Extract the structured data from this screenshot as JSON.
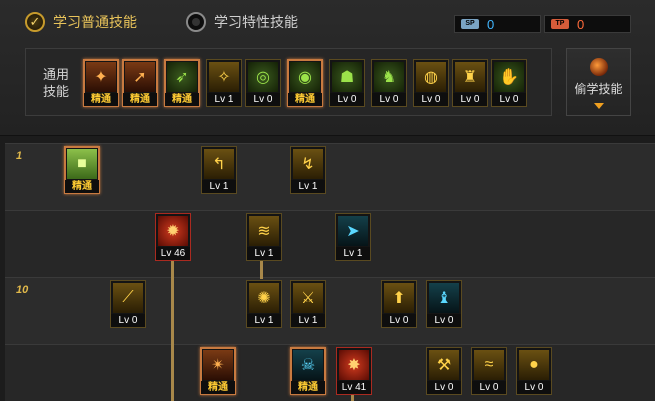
{
  "modes": {
    "normal_label": "学习普通技能",
    "special_label": "学习特性技能",
    "selected": "normal"
  },
  "currency": {
    "blue": {
      "tag": "SP",
      "value": "0"
    },
    "red": {
      "tag": "TP",
      "value": "0"
    }
  },
  "common": {
    "label_line1": "通用",
    "label_line2": "技能",
    "skills": [
      {
        "level": "精通",
        "master": true,
        "icon": "ground-slam-icon",
        "color": "orange"
      },
      {
        "level": "精通",
        "master": true,
        "icon": "leap-icon",
        "color": "orange"
      },
      {
        "level": "精通",
        "master": true,
        "icon": "dash-icon",
        "color": "green"
      },
      {
        "level": "Lv 1",
        "master": false,
        "icon": "wings-icon",
        "color": "gold"
      },
      {
        "level": "Lv 0",
        "master": false,
        "icon": "target-icon",
        "color": "green"
      },
      {
        "level": "精通",
        "master": true,
        "icon": "target-gear-icon",
        "color": "green"
      },
      {
        "level": "Lv 0",
        "master": false,
        "icon": "mushroom-icon",
        "color": "green"
      },
      {
        "level": "Lv 0",
        "master": false,
        "icon": "soldier-icon",
        "color": "green"
      },
      {
        "level": "Lv 0",
        "master": false,
        "icon": "eye-ring-icon",
        "color": "gold"
      },
      {
        "level": "Lv 0",
        "master": false,
        "icon": "figure-icon",
        "color": "gold"
      },
      {
        "level": "Lv 0",
        "master": false,
        "icon": "hand-icon",
        "color": "green"
      }
    ]
  },
  "steal": {
    "label": "偷学技能",
    "icon": "orb-icon"
  },
  "tree": {
    "row_labels": [
      "1",
      "",
      "10",
      ""
    ],
    "skills": [
      {
        "row": 0,
        "level": "精通",
        "master": true,
        "special": false,
        "icon": "block-icon",
        "color": "lime"
      },
      {
        "row": 0,
        "level": "Lv 1",
        "master": false,
        "special": false,
        "icon": "uppercut-icon",
        "color": "gold"
      },
      {
        "row": 0,
        "level": "Lv 1",
        "master": false,
        "special": false,
        "icon": "kick-icon",
        "color": "gold"
      },
      {
        "row": 1,
        "level": "Lv 46",
        "master": false,
        "special": true,
        "icon": "burst-icon",
        "color": "red"
      },
      {
        "row": 1,
        "level": "Lv 1",
        "master": false,
        "special": false,
        "icon": "rush-icon",
        "color": "gold"
      },
      {
        "row": 1,
        "level": "Lv 1",
        "master": false,
        "special": false,
        "icon": "gun-icon",
        "color": "cyan"
      },
      {
        "row": 2,
        "level": "Lv 0",
        "master": false,
        "special": false,
        "icon": "slash-icon",
        "color": "gold"
      },
      {
        "row": 2,
        "level": "Lv 1",
        "master": false,
        "special": false,
        "icon": "impact-icon",
        "color": "gold"
      },
      {
        "row": 2,
        "level": "Lv 1",
        "master": false,
        "special": false,
        "icon": "blade-icon",
        "color": "gold"
      },
      {
        "row": 2,
        "level": "Lv 0",
        "master": false,
        "special": false,
        "icon": "box-icon",
        "color": "gold"
      },
      {
        "row": 2,
        "level": "Lv 0",
        "master": false,
        "special": false,
        "icon": "beast-icon",
        "color": "cyan"
      },
      {
        "row": 3,
        "level": "精通",
        "master": true,
        "special": false,
        "icon": "whirl-icon",
        "color": "orange"
      },
      {
        "row": 3,
        "level": "精通",
        "master": true,
        "special": false,
        "icon": "beast-face-icon",
        "color": "cyan"
      },
      {
        "row": 3,
        "level": "Lv 41",
        "master": false,
        "special": true,
        "icon": "explosion-icon",
        "color": "red"
      },
      {
        "row": 3,
        "level": "Lv 0",
        "master": false,
        "special": false,
        "icon": "hammer-icon",
        "color": "gold"
      },
      {
        "row": 3,
        "level": "Lv 0",
        "master": false,
        "special": false,
        "icon": "wave-icon",
        "color": "gold"
      },
      {
        "row": 3,
        "level": "Lv 0",
        "master": false,
        "special": false,
        "icon": "grenade-icon",
        "color": "gold"
      }
    ]
  }
}
